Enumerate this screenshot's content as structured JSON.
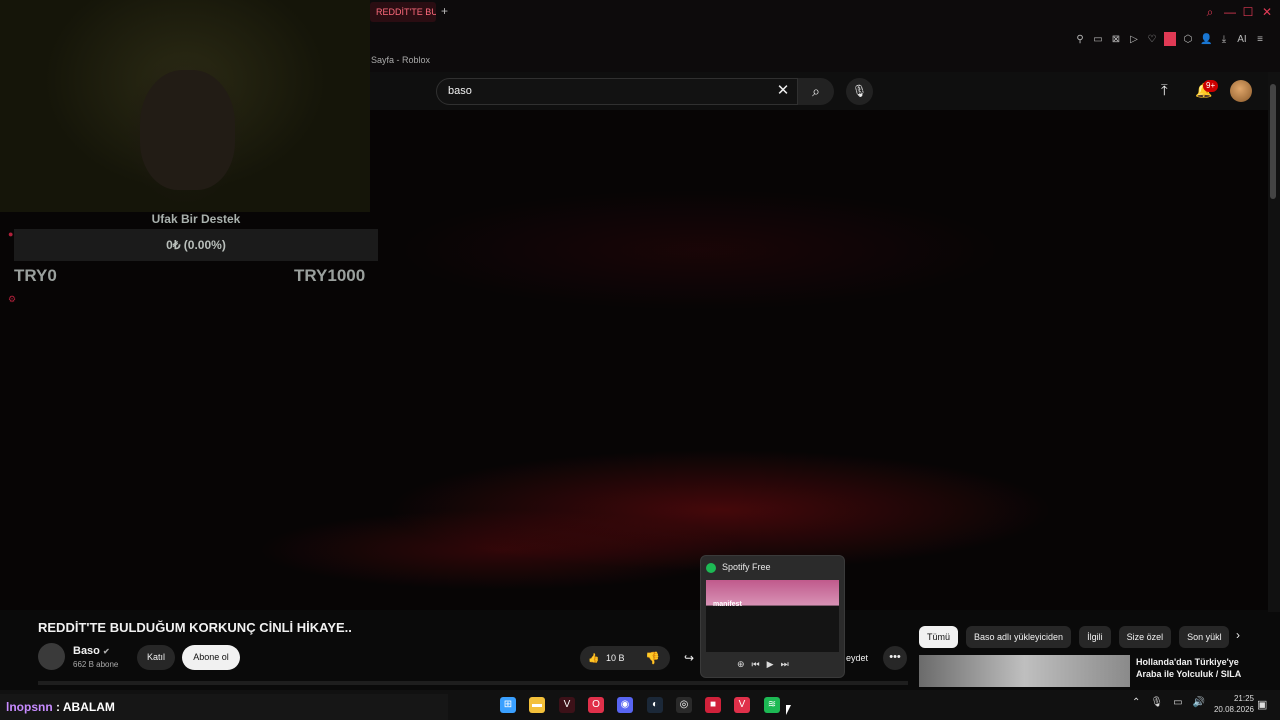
{
  "browser": {
    "active_tab_label": "REDDİT'TE BULDU",
    "new_tab": "+",
    "page_label": "Sayfa - Roblox",
    "win_search": "⌕",
    "win_min": "—",
    "win_max": "☐",
    "win_close": "✕",
    "extensions": [
      "⚲",
      "▭",
      "⊠",
      "▷",
      "♡",
      "⬡",
      "👤",
      "⤓",
      "AI",
      "≡"
    ]
  },
  "youtube_header": {
    "search_value": "baso",
    "clear_glyph": "✕",
    "search_glyph": "⌕",
    "mic_glyph": "🎙",
    "upload_glyph": "⤒",
    "bell_glyph": "🔔",
    "notif_badge": "9+"
  },
  "overlay": {
    "donation_title": "Ufak Bir Destek",
    "donation_progress": "0₺ (0.00%)",
    "donation_min": "TRY0",
    "donation_max": "TRY1000",
    "donation_fraction": 0.0
  },
  "video": {
    "title": "REDDİT'TE BULDUĞUM KORKUNÇ CİNLİ HİKAYE..",
    "channel_name": "Baso",
    "channel_verified": "✔",
    "channel_subs": "662 B abone",
    "join_label": "Katıl",
    "subscribe_label": "Abone ol",
    "like_glyph": "👍",
    "like_count": "10 B",
    "dislike_glyph": "👎",
    "share_glyph": "↪",
    "save_label": "eydet",
    "more_glyph": "•••"
  },
  "chips": [
    "Tümü",
    "Baso adlı yükleyiciden",
    "İlgili",
    "Size özel",
    "Son yükl"
  ],
  "chips_next": "›",
  "recommendation": {
    "title_line1": "Hollanda'dan Türkiye'ye",
    "title_line2": "Araba ile Yolculuk / SILA"
  },
  "spotify_preview": {
    "title": "Spotify Free",
    "shot_text": "manifest",
    "controls": [
      "⊕",
      "⏮",
      "▶",
      "⏭"
    ]
  },
  "chat": {
    "user": "lnopsnn",
    "message": " : ABALAM"
  },
  "taskbar": {
    "icons": [
      {
        "name": "windows-start-icon",
        "glyph": "⊞",
        "color": "#3aa0ff"
      },
      {
        "name": "file-explorer-icon",
        "glyph": "▬",
        "color": "#f3c03a"
      },
      {
        "name": "vivaldi-icon",
        "glyph": "V",
        "color": "#3c1118"
      },
      {
        "name": "opera-gx-icon",
        "glyph": "O",
        "color": "#e0304a"
      },
      {
        "name": "discord-icon",
        "glyph": "◉",
        "color": "#5865f2"
      },
      {
        "name": "steam-icon",
        "glyph": "◐",
        "color": "#1b2838"
      },
      {
        "name": "obs-icon",
        "glyph": "◎",
        "color": "#2a2a2a"
      },
      {
        "name": "red-app-icon",
        "glyph": "■",
        "color": "#d0213a"
      },
      {
        "name": "vivaldi-red-icon",
        "glyph": "V",
        "color": "#e0304a"
      },
      {
        "name": "spotify-icon",
        "glyph": "≋",
        "color": "#1db954"
      }
    ],
    "tray": [
      "⌃",
      "🎙",
      "▭",
      "🔊",
      "🔋"
    ],
    "time": "21:25",
    "date": "20.08.2026",
    "notify_glyph": "▣"
  }
}
